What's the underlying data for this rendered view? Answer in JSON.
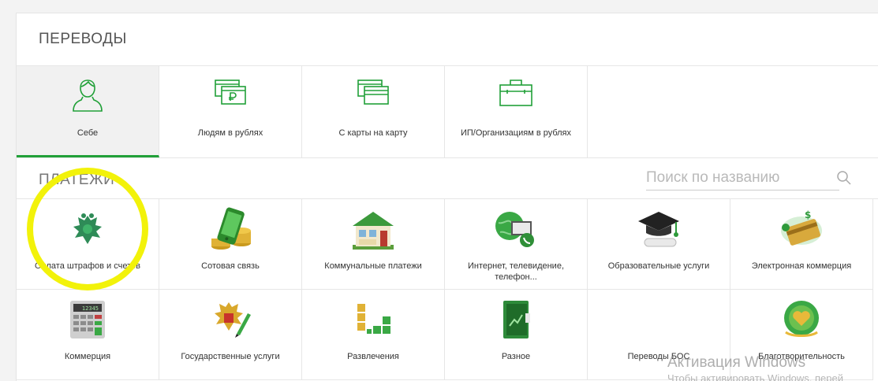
{
  "transfers": {
    "title": "ПЕРЕВОДЫ",
    "items": [
      {
        "label": "Себе",
        "icon": "person-icon",
        "active": true
      },
      {
        "label": "Людям в рублях",
        "icon": "ruble-cards-icon"
      },
      {
        "label": "С карты на карту",
        "icon": "cards-icon"
      },
      {
        "label": "ИП/Организациям в рублях",
        "icon": "briefcase-icon"
      }
    ]
  },
  "payments": {
    "title": "ПЛАТЕЖИ",
    "search_placeholder": "Поиск по названию",
    "items": [
      {
        "label": "Оплата штрафов и счетов",
        "icon": "emblem-icon"
      },
      {
        "label": "Сотовая связь",
        "icon": "phone-coins-icon"
      },
      {
        "label": "Коммунальные платежи",
        "icon": "house-icon"
      },
      {
        "label": "Интернет, телевидение, телефон...",
        "icon": "globe-phone-icon"
      },
      {
        "label": "Образовательные услуги",
        "icon": "graduation-cap-icon"
      },
      {
        "label": "Электронная коммерция",
        "icon": "ecommerce-card-icon"
      },
      {
        "label": "Коммерция",
        "icon": "calculator-icon"
      },
      {
        "label": "Государственные услуги",
        "icon": "emblem-pen-icon"
      },
      {
        "label": "Развлечения",
        "icon": "blocks-icon"
      },
      {
        "label": "Разное",
        "icon": "folder-icon"
      },
      {
        "label": "Переводы БОС",
        "icon": ""
      },
      {
        "label": "Благотворительность",
        "icon": "charity-heart-icon"
      }
    ]
  },
  "calculator_display": "12345",
  "watermark": {
    "line1": "Активация Windows",
    "line2": "Чтобы активировать Windows, перей"
  },
  "colors": {
    "accent": "#21a038",
    "highlight": "#f2f20a"
  }
}
